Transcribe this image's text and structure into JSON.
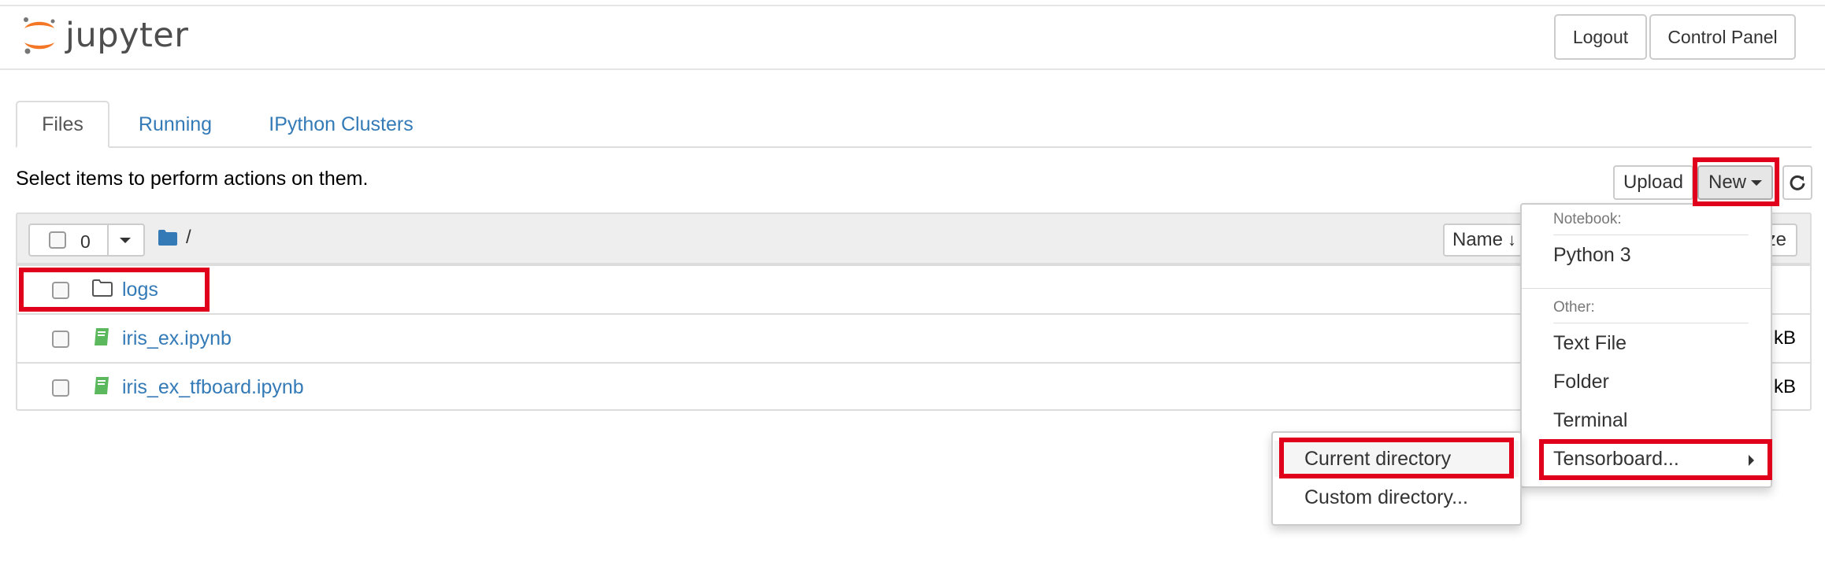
{
  "app": {
    "logo_text": "jupyter"
  },
  "header": {
    "logout_label": "Logout",
    "control_panel_label": "Control Panel"
  },
  "tabs": [
    {
      "label": "Files",
      "active": true
    },
    {
      "label": "Running",
      "active": false
    },
    {
      "label": "IPython Clusters",
      "active": false
    }
  ],
  "toolbar": {
    "hint": "Select items to perform actions on them.",
    "upload_label": "Upload",
    "new_label": "New",
    "refresh_icon": "refresh-icon"
  },
  "list_header": {
    "selected_count": "0",
    "breadcrumb": "/",
    "sort_name_label": "Name",
    "size_label_partial": "ze"
  },
  "files": [
    {
      "name": "logs",
      "type": "folder",
      "icon": "folder-icon",
      "size": ""
    },
    {
      "name": "iris_ex.ipynb",
      "type": "notebook",
      "icon": "notebook-icon",
      "size": "kB"
    },
    {
      "name": "iris_ex_tfboard.ipynb",
      "type": "notebook",
      "icon": "notebook-icon",
      "size": "kB"
    }
  ],
  "new_menu": {
    "notebook_header": "Notebook:",
    "notebook_items": [
      "Python 3"
    ],
    "other_header": "Other:",
    "other_items": [
      "Text File",
      "Folder",
      "Terminal",
      "Tensorboard..."
    ]
  },
  "tensorboard_submenu": {
    "items": [
      "Current directory",
      "Custom directory..."
    ]
  },
  "colors": {
    "link": "#337ab7",
    "highlight": "#e0001b",
    "notebook_icon": "#5cb85c",
    "folder_icon": "#337ab7",
    "logo_orange": "#f37726"
  }
}
